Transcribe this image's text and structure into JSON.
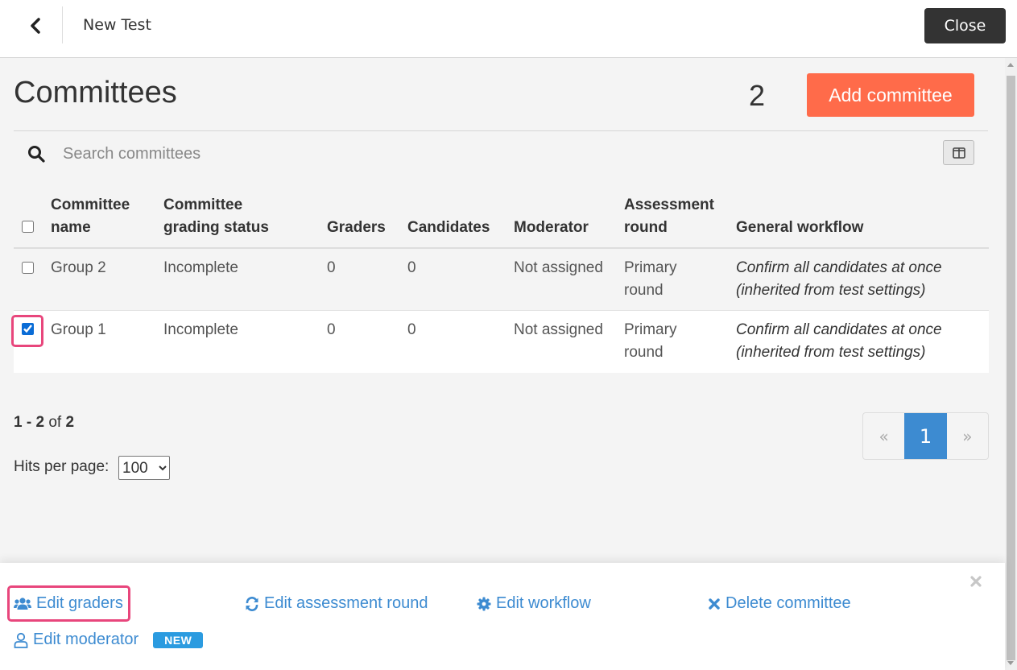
{
  "header": {
    "title": "New Test",
    "close_label": "Close"
  },
  "page": {
    "title": "Committees",
    "count": "2",
    "add_label": "Add committee"
  },
  "search": {
    "placeholder": "Search committees",
    "value": ""
  },
  "table": {
    "columns": [
      "Committee name",
      "Committee grading status",
      "Graders",
      "Candidates",
      "Moderator",
      "Assessment round",
      "General workflow"
    ],
    "column_lines": {
      "name": [
        "Committee",
        "name"
      ],
      "status": [
        "Committee",
        "grading status"
      ],
      "round": [
        "Assessment",
        "round"
      ]
    },
    "rows": [
      {
        "checked": false,
        "name": "Group 2",
        "status": "Incomplete",
        "graders": "0",
        "candidates": "0",
        "moderator": "Not assigned",
        "round_lines": [
          "Primary",
          "round"
        ],
        "workflow_lines": [
          "Confirm all candidates at once",
          "(inherited from test settings)"
        ]
      },
      {
        "checked": true,
        "name": "Group 1",
        "status": "Incomplete",
        "graders": "0",
        "candidates": "0",
        "moderator": "Not assigned",
        "round_lines": [
          "Primary",
          "round"
        ],
        "workflow_lines": [
          "Confirm all candidates at once",
          "(inherited from test settings)"
        ]
      }
    ]
  },
  "pagination": {
    "range_start": "1",
    "range_sep": " - ",
    "range_end": "2",
    "of_label": " of ",
    "total": "2",
    "hits_label": "Hits per page:",
    "hits_value": "100",
    "prev": "«",
    "current": "1",
    "next": "»"
  },
  "actions": {
    "edit_graders": "Edit graders",
    "edit_round": "Edit assessment round",
    "edit_workflow": "Edit workflow",
    "delete": "Delete committee",
    "edit_moderator": "Edit moderator",
    "new_badge": "NEW"
  },
  "colors": {
    "accent": "#3d8bd1",
    "add_button": "#ff6b4a",
    "highlight": "#e8467c",
    "badge": "#2b9be0"
  }
}
